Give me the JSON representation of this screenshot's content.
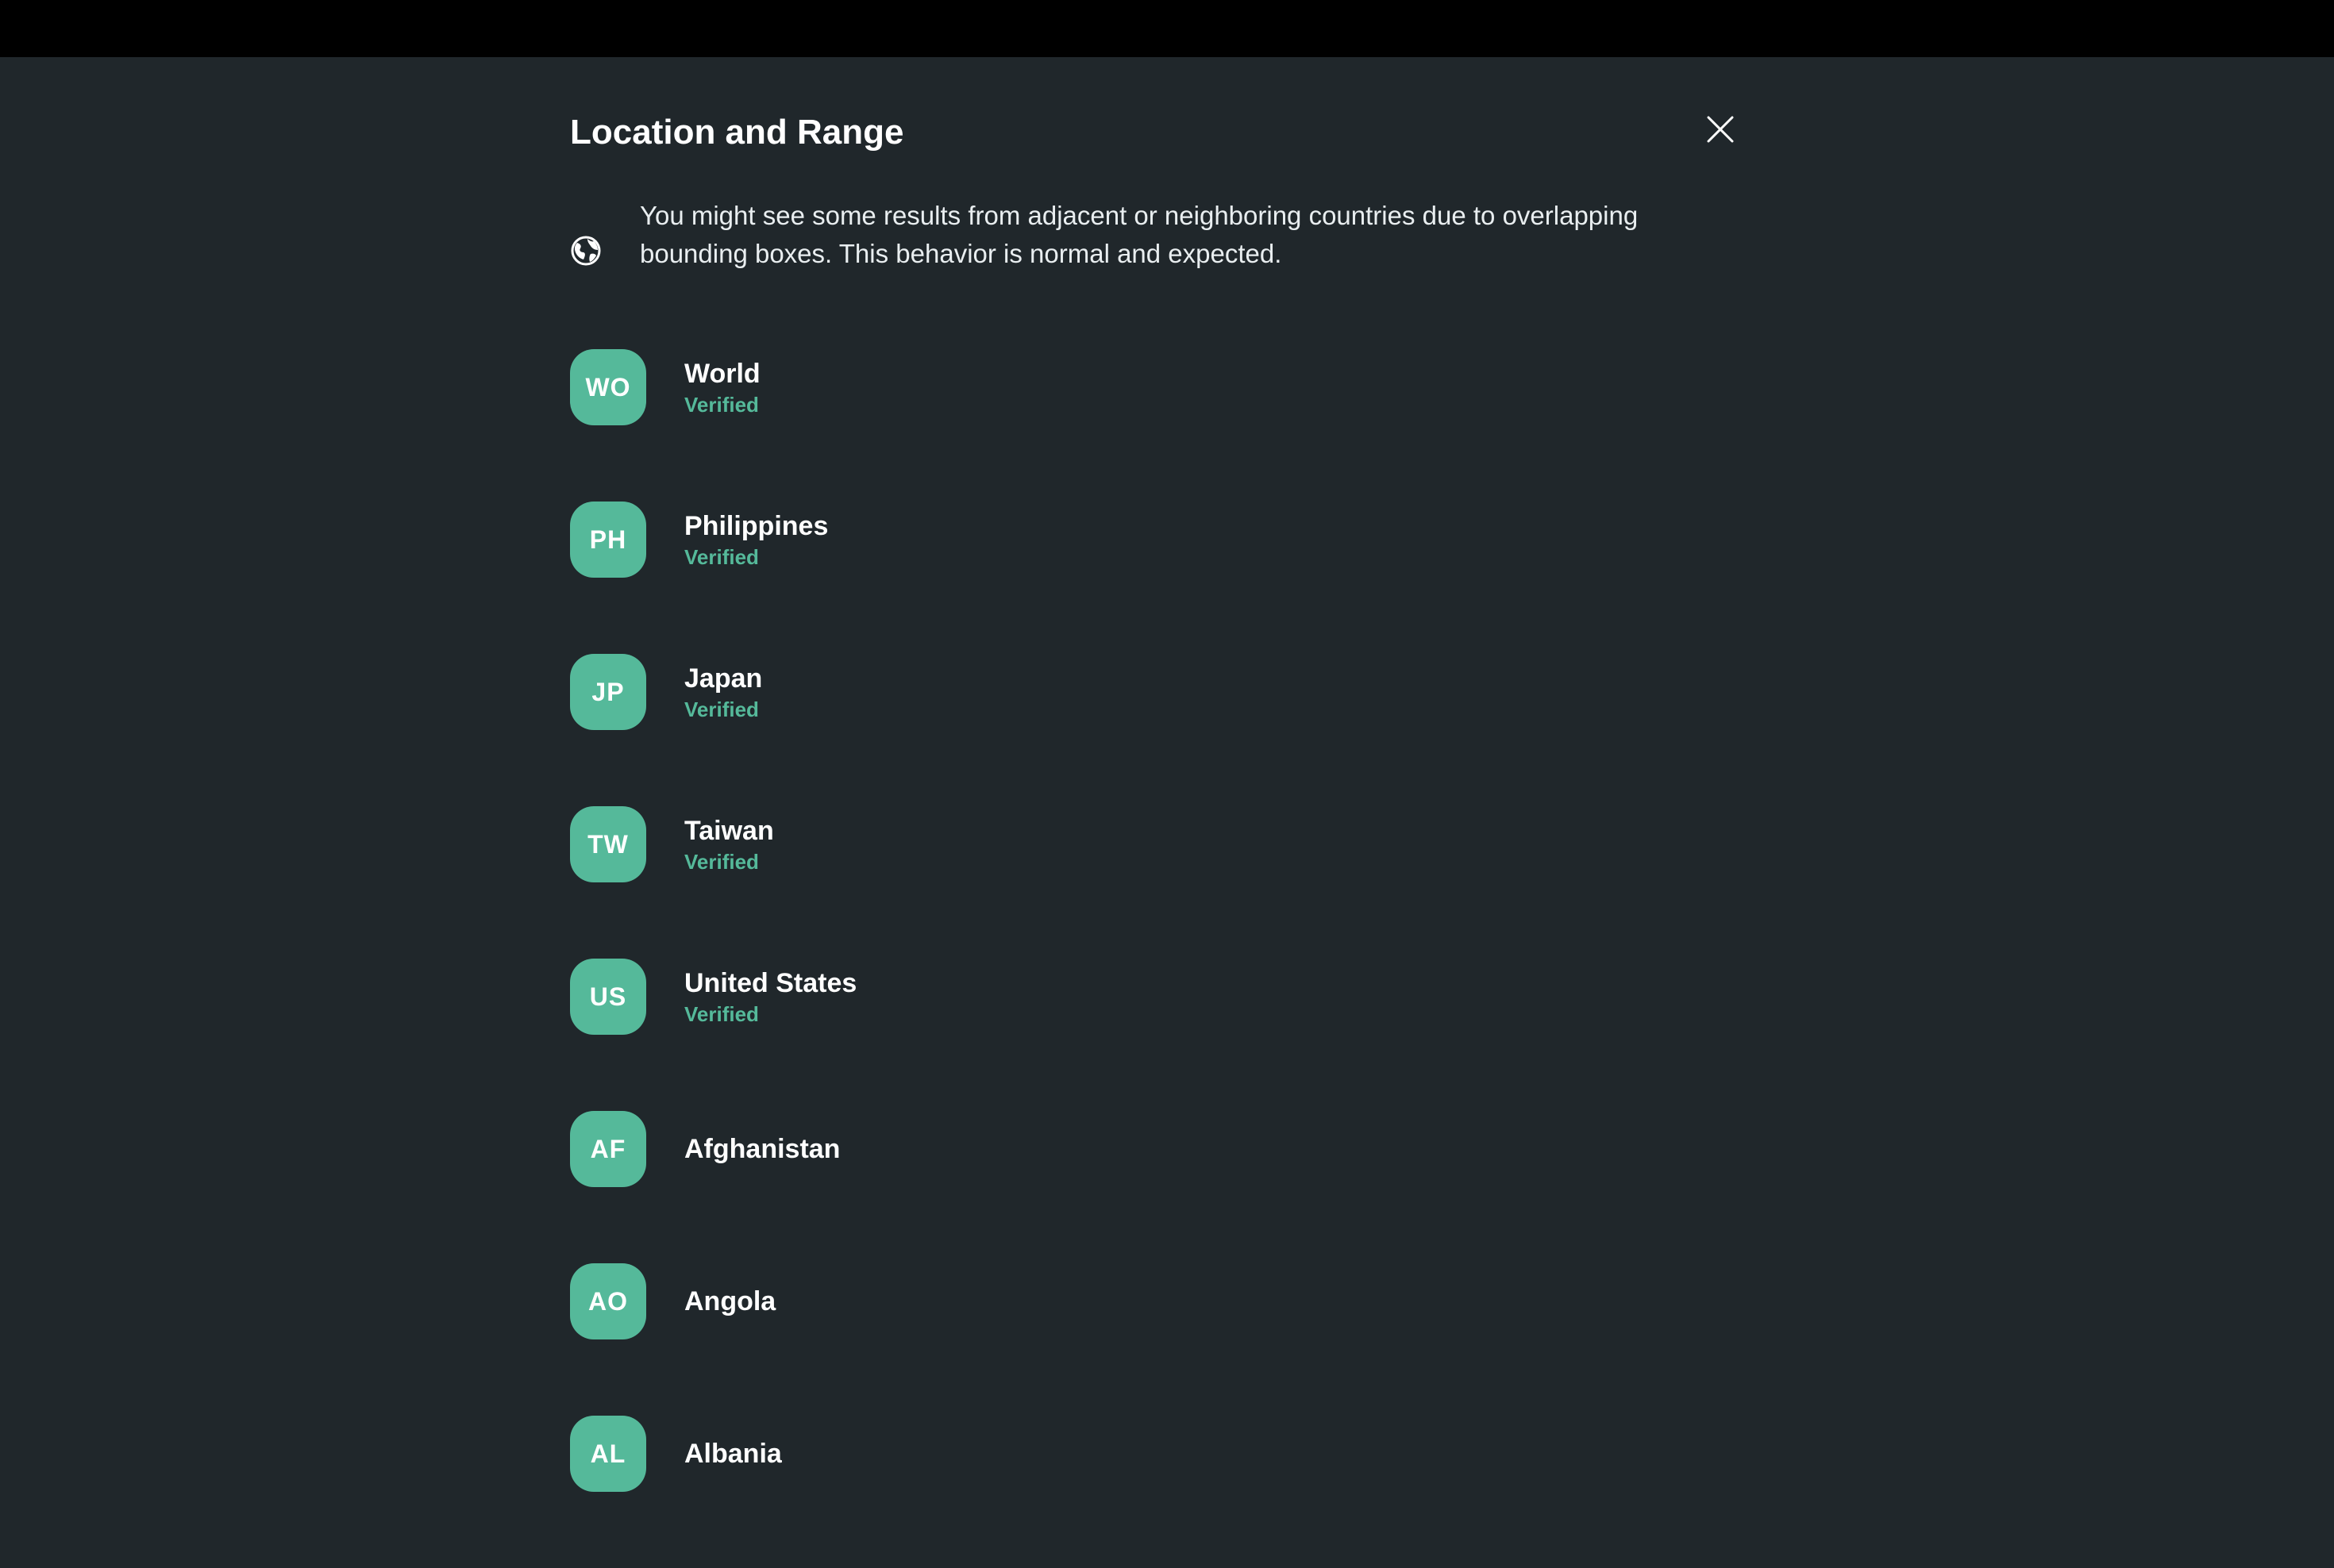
{
  "dialog": {
    "title": "Location and Range",
    "close_icon": "close-icon",
    "notice": {
      "icon": "globe-icon",
      "text": "You might see some results from adjacent or neighboring countries due to overlapping bounding boxes. This behavior is normal and expected."
    }
  },
  "colors": {
    "background": "#20272b",
    "topbar": "#000000",
    "accent": "#55b99a",
    "text": "#ffffff"
  },
  "countries": [
    {
      "code": "WO",
      "name": "World",
      "status": "Verified"
    },
    {
      "code": "PH",
      "name": "Philippines",
      "status": "Verified"
    },
    {
      "code": "JP",
      "name": "Japan",
      "status": "Verified"
    },
    {
      "code": "TW",
      "name": "Taiwan",
      "status": "Verified"
    },
    {
      "code": "US",
      "name": "United States",
      "status": "Verified"
    },
    {
      "code": "AF",
      "name": "Afghanistan",
      "status": ""
    },
    {
      "code": "AO",
      "name": "Angola",
      "status": ""
    },
    {
      "code": "AL",
      "name": "Albania",
      "status": ""
    }
  ]
}
